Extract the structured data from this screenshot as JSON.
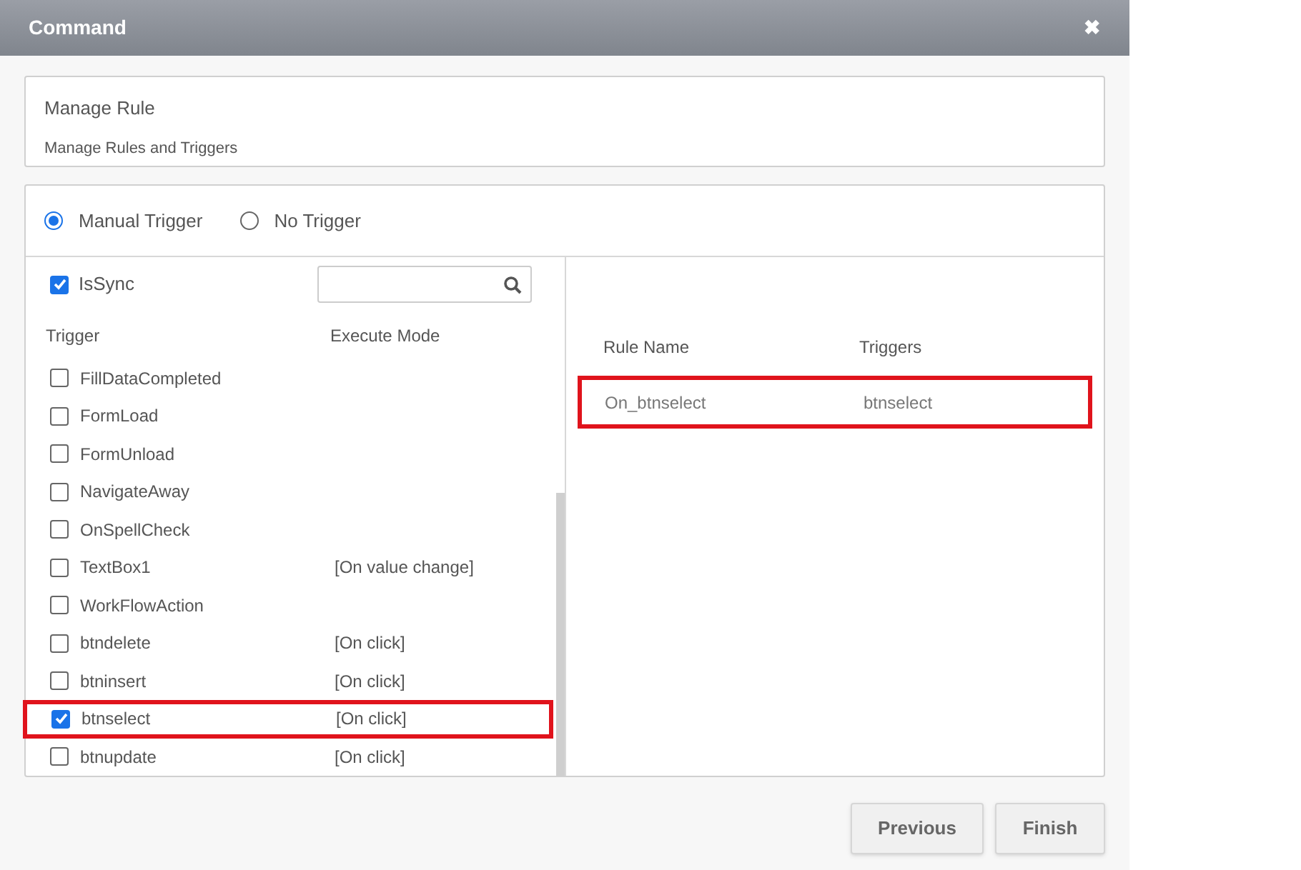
{
  "window": {
    "title": "Command",
    "close": "✖"
  },
  "header": {
    "title": "Manage Rule",
    "subtitle": "Manage Rules and Triggers"
  },
  "trigger_options": [
    {
      "label": "Manual Trigger",
      "selected": true
    },
    {
      "label": "No Trigger",
      "selected": false
    }
  ],
  "is_sync": {
    "label": "IsSync",
    "checked": true
  },
  "trigger_table": {
    "columns": [
      "Trigger",
      "Execute Mode"
    ],
    "rows": [
      {
        "trigger": "FillDataCompleted",
        "mode": "",
        "checked": false,
        "highlighted": false
      },
      {
        "trigger": "FormLoad",
        "mode": "",
        "checked": false,
        "highlighted": false
      },
      {
        "trigger": "FormUnload",
        "mode": "",
        "checked": false,
        "highlighted": false
      },
      {
        "trigger": "NavigateAway",
        "mode": "",
        "checked": false,
        "highlighted": false
      },
      {
        "trigger": "OnSpellCheck",
        "mode": "",
        "checked": false,
        "highlighted": false
      },
      {
        "trigger": "TextBox1",
        "mode": "[On value change]",
        "checked": false,
        "highlighted": false
      },
      {
        "trigger": "WorkFlowAction",
        "mode": "",
        "checked": false,
        "highlighted": false
      },
      {
        "trigger": "btndelete",
        "mode": "[On click]",
        "checked": false,
        "highlighted": false
      },
      {
        "trigger": "btninsert",
        "mode": "[On click]",
        "checked": false,
        "highlighted": false
      },
      {
        "trigger": "btnselect",
        "mode": "[On click]",
        "checked": true,
        "highlighted": true
      },
      {
        "trigger": "btnupdate",
        "mode": "[On click]",
        "checked": false,
        "highlighted": false
      }
    ]
  },
  "rule_table": {
    "columns": [
      "Rule Name",
      "Triggers"
    ],
    "rows": [
      {
        "rule_name": "On_btnselect",
        "triggers": "btnselect",
        "highlighted": true
      }
    ]
  },
  "buttons": [
    "Previous",
    "Finish"
  ]
}
